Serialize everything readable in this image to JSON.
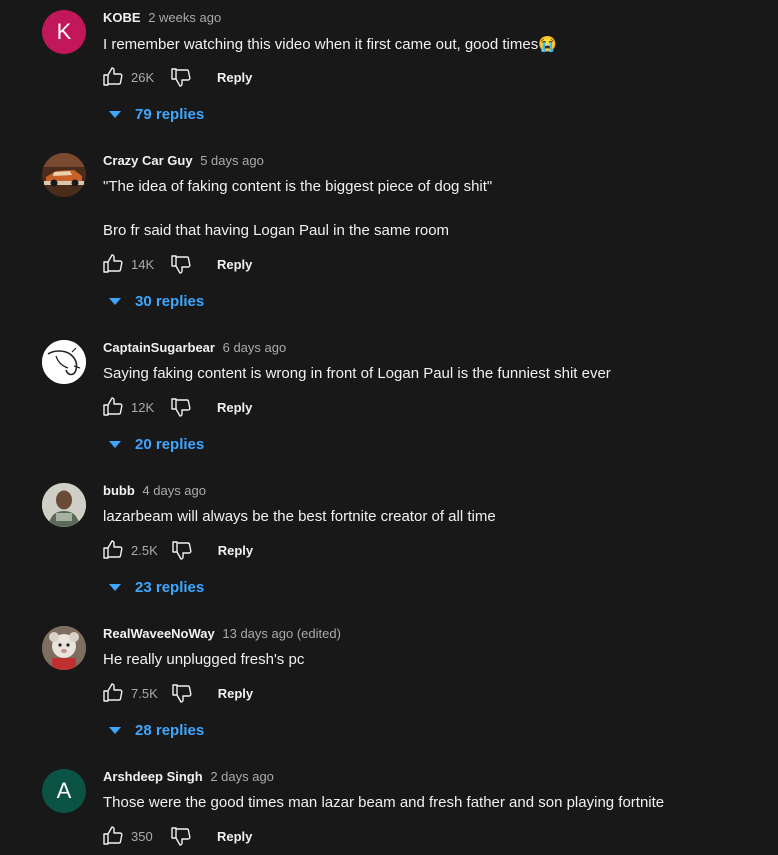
{
  "comments": [
    {
      "author": "KOBE",
      "time": "2 weeks ago",
      "avatar_letter": "K",
      "avatar_color": "#c2185b",
      "lines": [
        "I remember watching this video when it first came out, good times😭"
      ],
      "likes": "26K",
      "reply_label": "Reply",
      "replies": "79 replies"
    },
    {
      "author": "Crazy Car Guy",
      "time": "5 days ago",
      "avatar_icon": "car-photo-avatar",
      "lines": [
        "\"The idea of faking content is the biggest piece of dog shit\"",
        "Bro fr said that having Logan Paul in the same room"
      ],
      "likes": "14K",
      "reply_label": "Reply",
      "replies": "30 replies"
    },
    {
      "author": "CaptainSugarbear",
      "time": "6 days ago",
      "avatar_icon": "sketch-avatar",
      "lines": [
        "Saying faking content is wrong in front of Logan Paul is the funniest shit ever"
      ],
      "likes": "12K",
      "reply_label": "Reply",
      "replies": "20 replies"
    },
    {
      "author": "bubb",
      "time": "4 days ago",
      "avatar_icon": "person-photo-avatar",
      "lines": [
        "lazarbeam will always be the best fortnite creator of all time"
      ],
      "likes": "2.5K",
      "reply_label": "Reply",
      "replies": "23 replies"
    },
    {
      "author": "RealWaveeNoWay",
      "time": "13 days ago (edited)",
      "avatar_icon": "plush-toy-avatar",
      "lines": [
        "He really unplugged fresh's pc"
      ],
      "likes": "7.5K",
      "reply_label": "Reply",
      "replies": "28 replies"
    },
    {
      "author": "Arshdeep Singh",
      "time": "2 days ago",
      "avatar_letter": "A",
      "avatar_color": "#0b5345",
      "lines": [
        "Those were the good times man lazar beam and fresh father and son playing fortnite"
      ],
      "likes": "350",
      "reply_label": "Reply"
    }
  ],
  "colors": {
    "background": "#181818",
    "link_blue": "#3ea6ff",
    "secondary_text": "#aaaaaa"
  }
}
